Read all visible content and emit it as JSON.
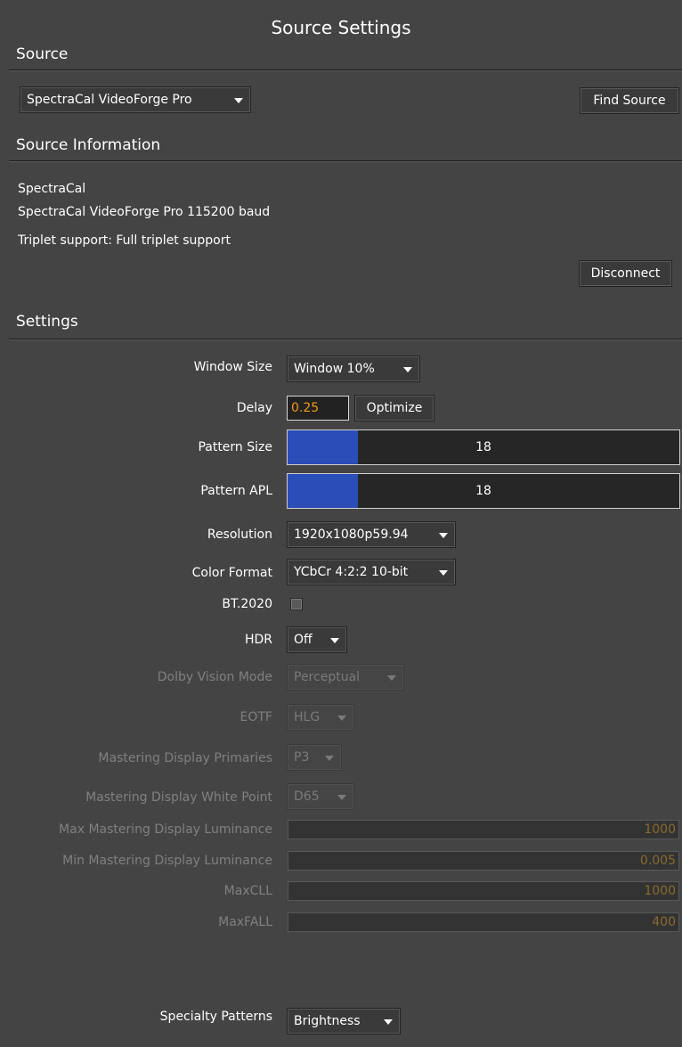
{
  "window_title": "Source Settings",
  "source": {
    "heading": "Source",
    "device_select": "SpectraCal VideoForge Pro",
    "find_source_label": "Find Source"
  },
  "source_info": {
    "heading": "Source Information",
    "manufacturer": "SpectraCal",
    "device_detail": "SpectraCal VideoForge Pro 115200 baud",
    "triplet": "Triplet support: Full triplet support",
    "disconnect_label": "Disconnect"
  },
  "settings": {
    "heading": "Settings",
    "window_size": {
      "label": "Window Size",
      "value": "Window 10%"
    },
    "delay": {
      "label": "Delay",
      "value": "0.25",
      "optimize_label": "Optimize"
    },
    "pattern_size": {
      "label": "Pattern Size",
      "value": "18",
      "fill_fraction": 0.18
    },
    "pattern_apl": {
      "label": "Pattern APL",
      "value": "18",
      "fill_fraction": 0.18
    },
    "resolution": {
      "label": "Resolution",
      "value": "1920x1080p59.94"
    },
    "color_format": {
      "label": "Color Format",
      "value": "YCbCr 4:2:2 10-bit"
    },
    "bt2020": {
      "label": "BT.2020",
      "checked": false
    },
    "hdr": {
      "label": "HDR",
      "value": "Off"
    },
    "dolby_vision_mode": {
      "label": "Dolby Vision Mode",
      "value": "Perceptual"
    },
    "eotf": {
      "label": "EOTF",
      "value": "HLG"
    },
    "mastering_primaries": {
      "label": "Mastering Display Primaries",
      "value": "P3"
    },
    "mastering_white_point": {
      "label": "Mastering Display White Point",
      "value": "D65"
    },
    "max_mastering_luminance": {
      "label": "Max Mastering Display Luminance",
      "value": "1000"
    },
    "min_mastering_luminance": {
      "label": "Min Mastering Display Luminance",
      "value": "0.005"
    },
    "maxcll": {
      "label": "MaxCLL",
      "value": "1000"
    },
    "maxfall": {
      "label": "MaxFALL",
      "value": "400"
    },
    "specialty_patterns": {
      "label": "Specialty Patterns",
      "value": "Brightness"
    }
  },
  "colors": {
    "background": "#444444",
    "slider_fill": "#2a4db8",
    "delay_text": "#f29a1a",
    "disabled_value_text": "#8a6a2e"
  }
}
